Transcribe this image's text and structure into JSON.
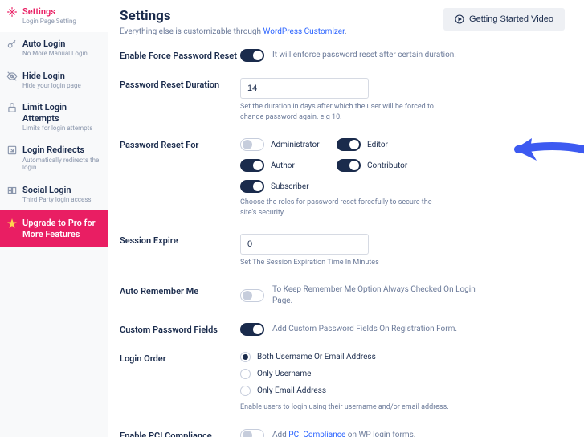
{
  "sidebar": {
    "items": [
      {
        "label": "Settings",
        "sub": "Login Page Setting",
        "icon": "settings"
      },
      {
        "label": "Auto Login",
        "sub": "No More Manual Login",
        "icon": "key"
      },
      {
        "label": "Hide Login",
        "sub": "Hide your login page",
        "icon": "eye-off"
      },
      {
        "label": "Limit Login Attempts",
        "sub": "Limits for login attempts",
        "icon": "lock"
      },
      {
        "label": "Login Redirects",
        "sub": "Automatically redirects the login",
        "icon": "redirect"
      },
      {
        "label": "Social Login",
        "sub": "Third Party login access",
        "icon": "social"
      }
    ],
    "upgrade": "Upgrade to Pro for More Features"
  },
  "header": {
    "title": "Settings",
    "desc_prefix": "Everything else is customizable through ",
    "desc_link": "WordPress Customizer",
    "video_btn": "Getting Started Video"
  },
  "fields": {
    "force_reset": {
      "label": "Enable Force Password Reset",
      "desc": "It will enforce password reset after certain duration."
    },
    "duration": {
      "label": "Password Reset Duration",
      "value": "14",
      "hint": "Set the duration in days after which the user will be forced to change password again. e.g 10."
    },
    "reset_for": {
      "label": "Password Reset For",
      "roles": {
        "administrator": "Administrator",
        "editor": "Editor",
        "author": "Author",
        "contributor": "Contributor",
        "subscriber": "Subscriber"
      },
      "hint": "Choose the roles for password reset forcefully to secure the site's security."
    },
    "session": {
      "label": "Session Expire",
      "value": "0",
      "hint": "Set The Session Expiration Time In Minutes"
    },
    "remember": {
      "label": "Auto Remember Me",
      "desc": "To Keep Remember Me Option Always Checked On Login Page."
    },
    "custom_pw": {
      "label": "Custom Password Fields",
      "desc": "Add Custom Password Fields On Registration Form."
    },
    "login_order": {
      "label": "Login Order",
      "options": {
        "both": "Both Username Or Email Address",
        "user": "Only Username",
        "email": "Only Email Address"
      },
      "hint": "Enable users to login using their username and/or email address."
    },
    "pci": {
      "label": "Enable PCI Compliance",
      "desc_prefix": "Add ",
      "desc_link": "PCI Compliance",
      "desc_suffix": " on WP login forms."
    }
  }
}
